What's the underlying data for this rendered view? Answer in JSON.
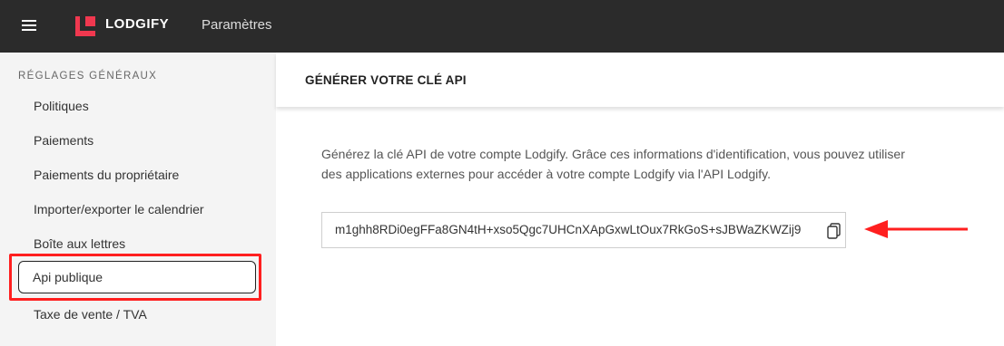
{
  "header": {
    "menu_icon": "hamburger-menu-icon",
    "logo_icon": "lodgify-logo-icon",
    "brand": "LODGIFY",
    "title": "Paramètres"
  },
  "sidebar": {
    "section_heading": "RÉGLAGES GÉNÉRAUX",
    "items": [
      {
        "label": "Politiques"
      },
      {
        "label": "Paiements"
      },
      {
        "label": "Paiements du propriétaire"
      },
      {
        "label": "Importer/exporter le calendrier"
      },
      {
        "label": "Boîte aux lettres"
      },
      {
        "label": "Api publique",
        "active": true
      },
      {
        "label": "Taxe de vente / TVA"
      }
    ]
  },
  "main": {
    "title": "GÉNÉRER VOTRE CLÉ API",
    "description": "Générez la clé API de votre compte Lodgify. Grâce ces informations d'identification, vous pouvez utiliser des applications externes pour accéder à votre compte Lodgify via l'API Lodgify.",
    "api_key": "m1ghh8RDi0egFFa8GN4tH+xso5Qgc7UHCnXApGxwLtOux7RkGoS+sJBWaZKWZij9",
    "copy_icon": "copy-icon"
  },
  "colors": {
    "topbar": "#2b2b2b",
    "brand_red": "#f0384f",
    "annotation_red": "#ff1f1f"
  }
}
